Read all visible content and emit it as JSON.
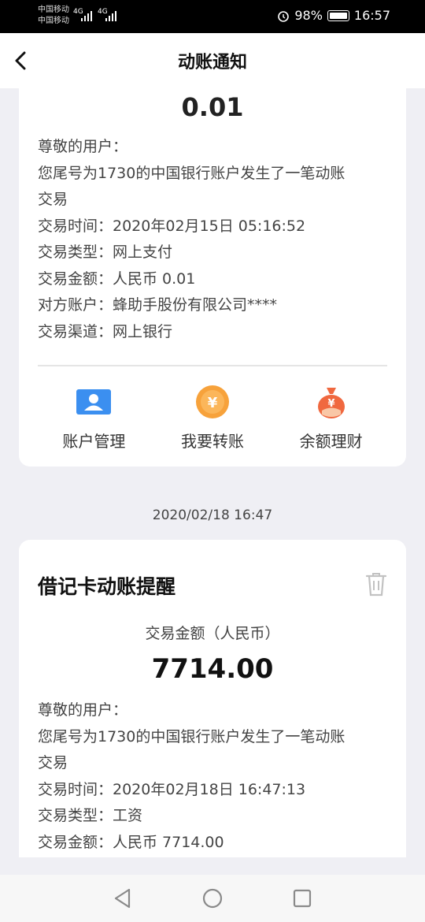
{
  "status_bar": {
    "carrier1": "中国移动",
    "carrier2": "中国移动",
    "sig1": "4G",
    "sig2": "4G",
    "battery": "98%",
    "time": "16:57"
  },
  "nav": {
    "title": "动账通知"
  },
  "card1": {
    "amount": "0.01",
    "lines": [
      "尊敬的用户：",
      "您尾号为1730的中国银行账户发生了一笔动账",
      "交易",
      "交易时间：2020年02月15日 05:16:52",
      "交易类型：网上支付",
      "交易金额：人民币 0.01",
      "对方账户：蜂助手股份有限公司****",
      "交易渠道：网上银行"
    ],
    "actions": [
      {
        "label": "账户管理",
        "icon": "account-card-icon",
        "color": "#2f8fe8"
      },
      {
        "label": "我要转账",
        "icon": "yuan-coin-icon",
        "color": "#f59a23"
      },
      {
        "label": "余额理财",
        "icon": "money-bag-icon",
        "color": "#f26b4a"
      }
    ]
  },
  "separator_date": "2020/02/18 16:47",
  "card2": {
    "title": "借记卡动账提醒",
    "amount_label": "交易金额（人民币）",
    "amount": "7714.00",
    "lines": [
      "尊敬的用户：",
      "您尾号为1730的中国银行账户发生了一笔动账",
      "交易",
      "交易时间：2020年02月18日 16:47:13",
      "交易类型：工资",
      "交易金额：人民币 7714.00"
    ]
  }
}
